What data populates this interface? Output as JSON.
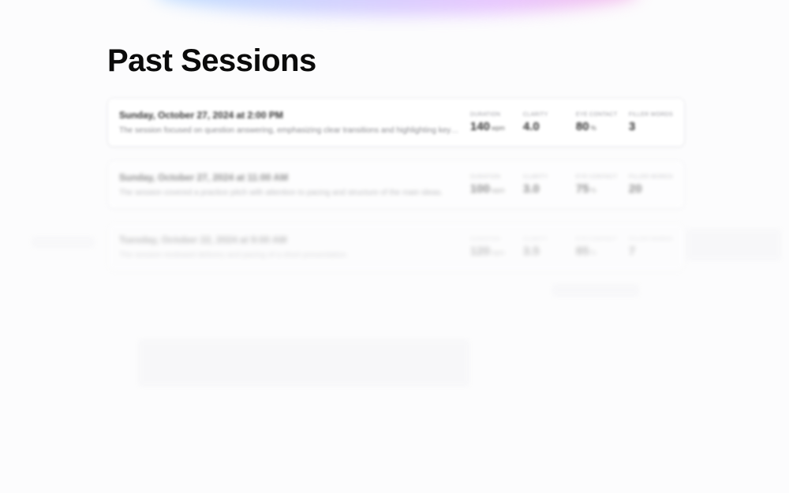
{
  "page": {
    "title": "Past Sessions"
  },
  "sessions": [
    {
      "date": "Sunday, October 27, 2024 at 2:00 PM",
      "summary": "The session focused on question answering, emphasizing clear transitions and highlighting key points.",
      "metrics": [
        {
          "label": "Duration",
          "value": "140",
          "unit": "wpm"
        },
        {
          "label": "Clarity",
          "value": "4.0",
          "unit": ""
        },
        {
          "label": "Eye contact",
          "value": "80",
          "unit": "%"
        },
        {
          "label": "Filler words",
          "value": "3",
          "unit": ""
        }
      ]
    },
    {
      "date": "Sunday, October 27, 2024 at 11:00 AM",
      "summary": "The session covered a practice pitch with attention to pacing and structure of the main ideas.",
      "metrics": [
        {
          "label": "Duration",
          "value": "100",
          "unit": "wpm"
        },
        {
          "label": "Clarity",
          "value": "3.0",
          "unit": ""
        },
        {
          "label": "Eye contact",
          "value": "75",
          "unit": "%"
        },
        {
          "label": "Filler words",
          "value": "20",
          "unit": ""
        }
      ]
    },
    {
      "date": "Tuesday, October 22, 2024 at 9:00 AM",
      "summary": "The session reviewed delivery and pacing of a short presentation.",
      "metrics": [
        {
          "label": "Duration",
          "value": "120",
          "unit": "wpm"
        },
        {
          "label": "Clarity",
          "value": "3.5",
          "unit": ""
        },
        {
          "label": "Eye contact",
          "value": "85",
          "unit": "%"
        },
        {
          "label": "Filler words",
          "value": "7",
          "unit": ""
        }
      ]
    }
  ]
}
